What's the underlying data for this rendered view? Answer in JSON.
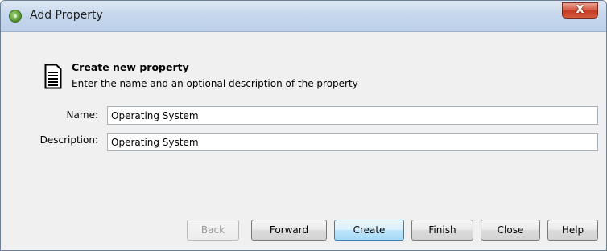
{
  "window": {
    "title": "Add Property",
    "close_label": "X"
  },
  "header": {
    "icon": "document-icon",
    "title": "Create new property",
    "description": "Enter the name and an optional description of the property"
  },
  "form": {
    "name_label": "Name:",
    "name_value": "Operating System",
    "description_label": "Description:",
    "description_value": "Operating System"
  },
  "buttons": {
    "back": "Back",
    "forward": "Forward",
    "create": "Create",
    "finish": "Finish",
    "close": "Close",
    "help": "Help"
  },
  "colors": {
    "titlebar": "#c6d7ec",
    "close_button": "#c23b22",
    "dialog_background": "#f0f0f0",
    "default_button": "#bee6fd"
  }
}
